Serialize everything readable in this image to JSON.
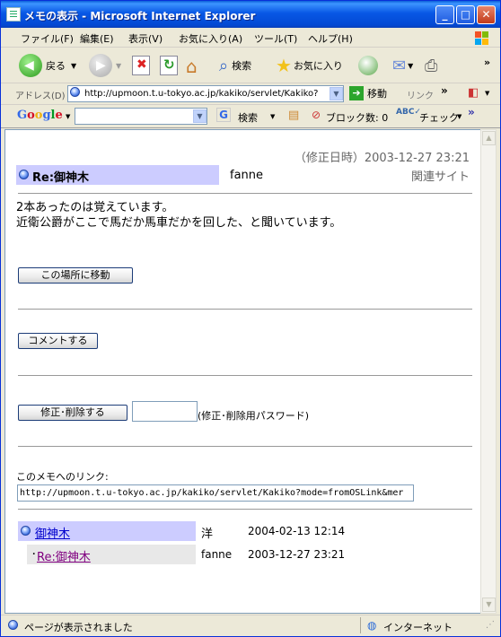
{
  "window": {
    "title": "メモの表示 - Microsoft Internet Explorer",
    "min": "_",
    "max": "□",
    "close": "✕"
  },
  "menu": {
    "items": [
      "ファイル(F)",
      "編集(E)",
      "表示(V)",
      "お気に入り(A)",
      "ツール(T)",
      "ヘルプ(H)"
    ]
  },
  "toolbar": {
    "back_label": "戻る",
    "search_label": "検索",
    "favorites_label": "お気に入り",
    "more": "»"
  },
  "address": {
    "label": "アドレス(D)",
    "url": "http://upmoon.t.u-tokyo.ac.jp/kakiko/servlet/Kakiko?",
    "go_label": "移動",
    "links_label": "リンク",
    "more": "»"
  },
  "googlebar": {
    "logo": "Google",
    "search_label": "検索",
    "block_label": "ブロック数: 0",
    "check_label": "チェック",
    "more": "»"
  },
  "memo": {
    "modified": "（修正日時）2003-12-27 23:21",
    "title": "Re:御神木",
    "author": "fanne",
    "related": "関連サイト",
    "body_line1": "2本あったのは覚えています。",
    "body_line2": "近衛公爵がここで馬だか馬車だかを回した、と聞いています。",
    "move_button": "この場所に移動",
    "comment_button": "コメントする",
    "edit_button": "修正･削除する",
    "password_hint": "(修正･削除用パスワード)",
    "password_value": "",
    "link_label": "このメモへのリンク:",
    "link_url": "http://upmoon.t.u-tokyo.ac.jp/kakiko/servlet/Kakiko?mode=fromOSLink&mer"
  },
  "thread": [
    {
      "title": "御神木",
      "author": "洋",
      "date": "2004-02-13 12:14"
    },
    {
      "title": "Re:御神木",
      "author": "fanne",
      "date": "2003-12-27 23:21"
    }
  ],
  "status": {
    "text": "ページが表示されました",
    "zone": "インターネット"
  },
  "colors": {
    "title_bg": "#ccccff",
    "reply_bg": "#e8e8e8",
    "link": "#0000cc",
    "visited": "#800080"
  }
}
